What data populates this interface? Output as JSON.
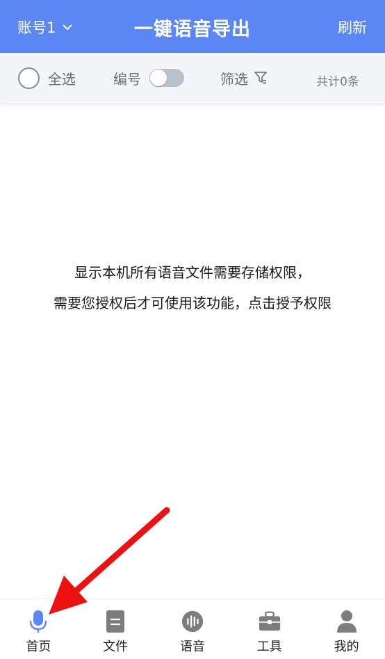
{
  "header": {
    "account_label": "账号1",
    "title": "一键语音导出",
    "refresh_label": "刷新"
  },
  "toolbar": {
    "select_all_label": "全选",
    "numbering_label": "编号",
    "numbering_enabled": false,
    "filter_label": "筛选",
    "count_text": "共计0条"
  },
  "content": {
    "message_line1": "显示本机所有语音文件需要存储权限，",
    "message_line2": "需要您授权后才可使用该功能，点击授予权限"
  },
  "bottom_nav": {
    "items": [
      {
        "label": "首页",
        "icon": "microphone-icon",
        "active": true
      },
      {
        "label": "文件",
        "icon": "document-icon",
        "active": false
      },
      {
        "label": "语音",
        "icon": "voice-wave-icon",
        "active": false
      },
      {
        "label": "工具",
        "icon": "toolbox-icon",
        "active": false
      },
      {
        "label": "我的",
        "icon": "user-icon",
        "active": false
      }
    ]
  },
  "colors": {
    "brand": "#5b87f5",
    "nav_icon_inactive": "#7d7d7d",
    "annotation_arrow": "#ee1111"
  }
}
